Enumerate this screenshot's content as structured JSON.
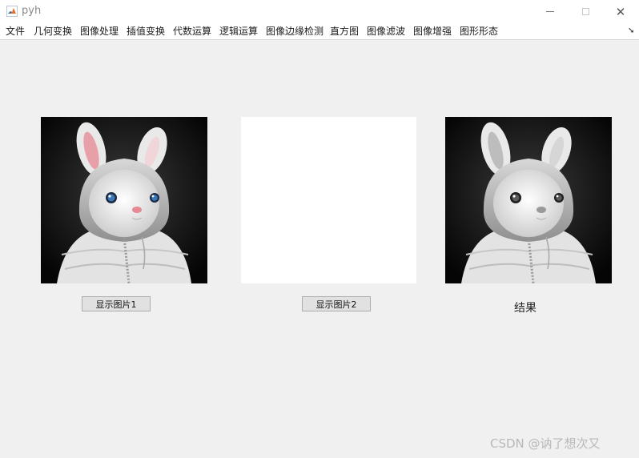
{
  "window": {
    "title": "pyh"
  },
  "menu": {
    "items": [
      "文件",
      "几何变换",
      "图像处理",
      "插值变换",
      "代数运算",
      "逻辑运算",
      "图像边缘检测",
      "直方图",
      "图像滤波",
      "图像增强",
      "图形形态"
    ]
  },
  "axes": {
    "left_image": "color-bunny-image",
    "middle_image": "blank",
    "right_image": "grayscale-bunny-image"
  },
  "buttons": {
    "show1": "显示图片1",
    "show2": "显示图片2"
  },
  "labels": {
    "result": "结果"
  },
  "watermark": "CSDN @讷了想次又",
  "colors": {
    "background": "#f0f0f0",
    "titlebar": "#ffffff",
    "button_face": "#e1e1e1",
    "button_border": "#adadad"
  }
}
